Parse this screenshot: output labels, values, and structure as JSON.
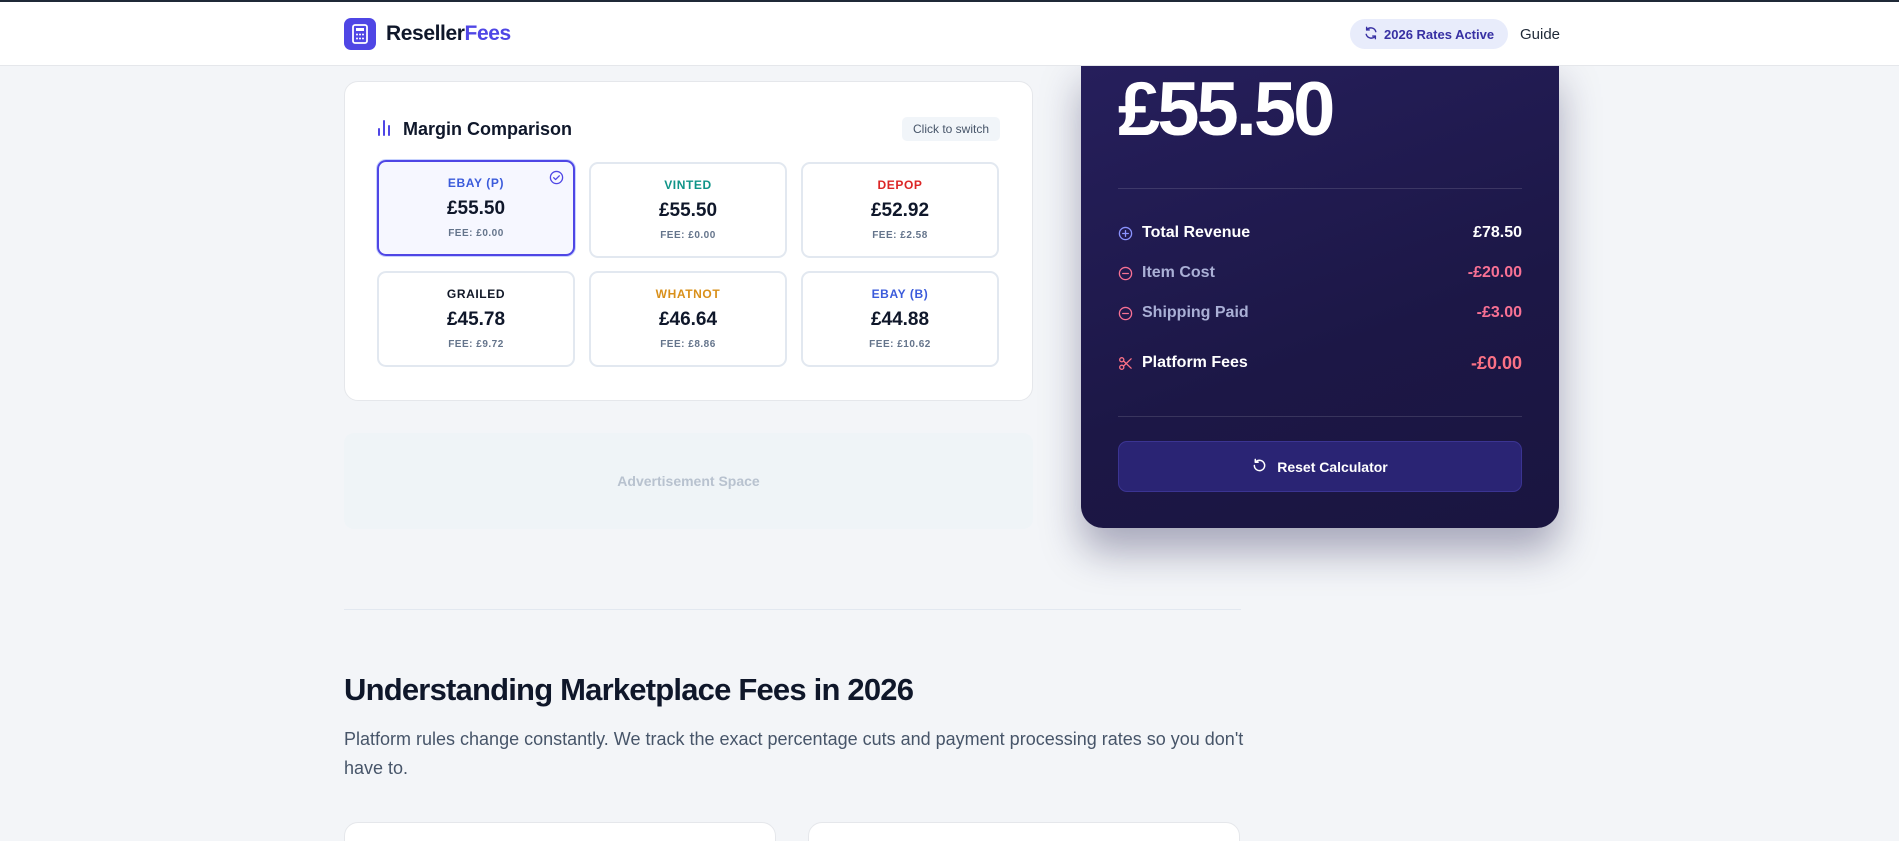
{
  "header": {
    "brand_main": "Reseller",
    "brand_accent": "Fees",
    "rates_badge": "2026 Rates Active",
    "guide_link": "Guide"
  },
  "comparison": {
    "title": "Margin Comparison",
    "switch_hint": "Click to switch",
    "tiles": [
      {
        "name": "EBAY (P)",
        "profit": "£55.50",
        "fee": "FEE: £0.00",
        "color": "#3b5bdb",
        "selected": true
      },
      {
        "name": "VINTED",
        "profit": "£55.50",
        "fee": "FEE: £0.00",
        "color": "#0f9488",
        "selected": false
      },
      {
        "name": "DEPOP",
        "profit": "£52.92",
        "fee": "FEE: £2.58",
        "color": "#dc2626",
        "selected": false
      },
      {
        "name": "GRAILED",
        "profit": "£45.78",
        "fee": "FEE: £9.72",
        "color": "#111827",
        "selected": false
      },
      {
        "name": "WHATNOT",
        "profit": "£46.64",
        "fee": "FEE: £8.86",
        "color": "#d9901a",
        "selected": false
      },
      {
        "name": "EBAY (B)",
        "profit": "£44.88",
        "fee": "FEE: £10.62",
        "color": "#3b5bdb",
        "selected": false
      }
    ]
  },
  "ad": {
    "label": "Advertisement Space"
  },
  "result": {
    "profit": "£55.50",
    "rows": {
      "revenue": {
        "label": "Total Revenue",
        "value": "£78.50"
      },
      "item_cost": {
        "label": "Item Cost",
        "value": "-£20.00"
      },
      "shipping": {
        "label": "Shipping Paid",
        "value": "-£3.00"
      },
      "fees": {
        "label": "Platform Fees",
        "value": "-£0.00"
      }
    },
    "reset_label": "Reset Calculator"
  },
  "article": {
    "title": "Understanding Marketplace Fees in 2026",
    "description": "Platform rules change constantly. We track the exact percentage cuts and payment processing rates so you don't have to."
  },
  "colors": {
    "brand": "#4f46e5",
    "card_dark": "#1c1746",
    "negative": "#f87194"
  }
}
